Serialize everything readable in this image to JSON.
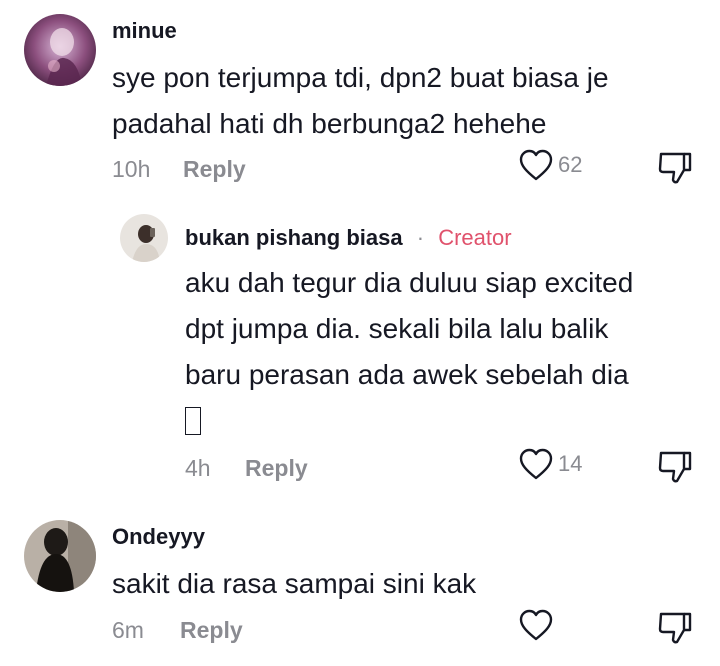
{
  "comments": [
    {
      "username": "minue",
      "lines": [
        "sye pon terjumpa tdi, dpn2 buat biasa je",
        "padahal hati dh berbunga2 hehehe"
      ],
      "time": "10h",
      "reply_label": "Reply",
      "likes": "62",
      "icons": {
        "like": "heart-outline-icon",
        "dislike": "thumbs-down-icon"
      }
    },
    {
      "username": "bukan pishang biasa",
      "separator": "·",
      "badge": "Creator",
      "lines": [
        "aku dah tegur dia duluu siap excited",
        "dpt jumpa dia. sekali bila lalu balik",
        "baru perasan ada awek sebelah dia"
      ],
      "emoji": "",
      "time": "4h",
      "reply_label": "Reply",
      "likes": "14",
      "icons": {
        "like": "heart-outline-icon",
        "dislike": "thumbs-down-icon"
      }
    },
    {
      "username": "Ondeyyy",
      "lines": [
        "sakit dia rasa sampai sini kak"
      ],
      "time": "6m",
      "reply_label": "Reply",
      "likes": "",
      "icons": {
        "like": "heart-outline-icon",
        "dislike": "thumbs-down-icon"
      }
    }
  ],
  "colors": {
    "text": "#161823",
    "muted": "#8a8b91",
    "creator": "#e0526c"
  }
}
